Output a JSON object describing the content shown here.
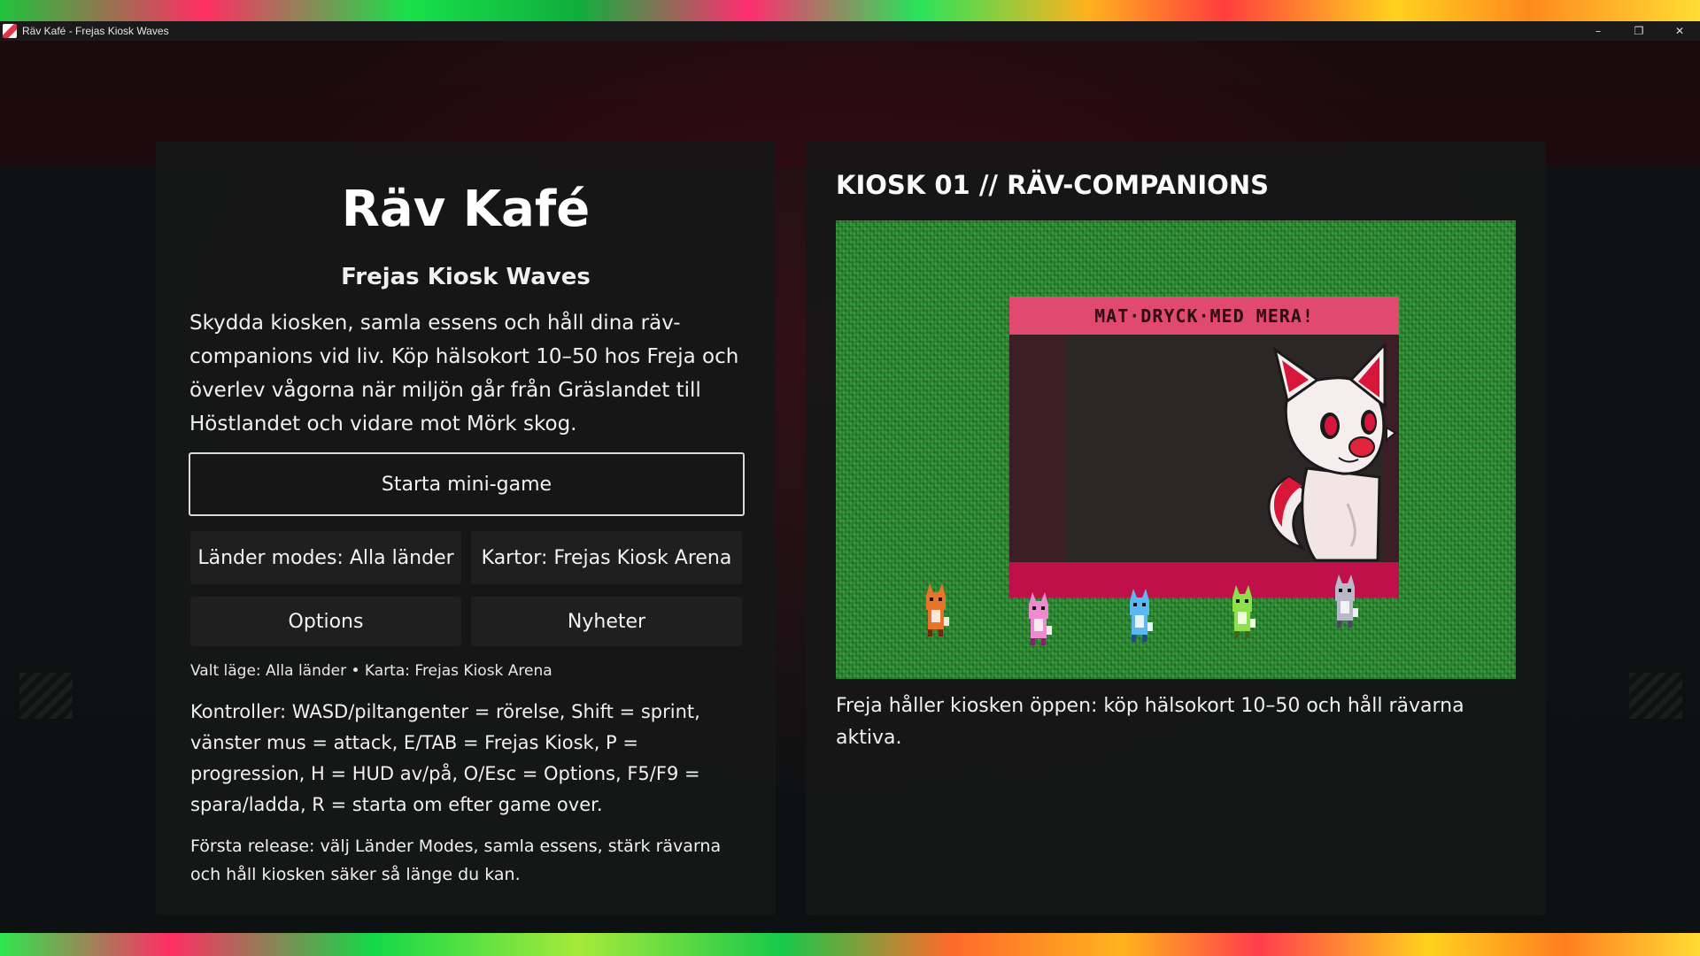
{
  "window": {
    "title": "Räv Kafé - Frejas Kiosk Waves",
    "controls": {
      "minimize": "–",
      "maximize": "❐",
      "close": "✕"
    }
  },
  "menu": {
    "title": "Räv Kafé",
    "subtitle": "Frejas Kiosk Waves",
    "intro": "Skydda kiosken, samla essens och håll dina räv-companions vid liv. Köp hälsokort 10–50 hos Freja och överlev vågorna när miljön går från Gräslandet till Höstlandet och vidare mot Mörk skog.",
    "start_button": "Starta mini-game",
    "mode_button": "Länder modes: Alla länder",
    "map_button": "Kartor: Frejas Kiosk Arena",
    "options_button": "Options",
    "news_button": "Nyheter",
    "selected_status": "Valt läge: Alla länder • Karta: Frejas Kiosk Arena",
    "controls_text": "Kontroller: WASD/piltangenter = rörelse, Shift = sprint, vänster mus = attack, E/TAB = Frejas Kiosk, P = progression, H = HUD av/på, O/Esc = Options, F5/F9 = spara/ladda, R = starta om efter game over.",
    "release_text": "Första release: välj Länder Modes, samla essens, stärk rävarna och håll kiosken säker så länge du kan."
  },
  "kiosk": {
    "heading": "KIOSK 01 // RÄV-COMPANIONS",
    "sign": "MAT·DRYCK·MED MERA!",
    "caption": "Freja håller kiosken öppen: köp hälsokort 10–50 och håll rävarna aktiva.",
    "companions": [
      {
        "color": "#e8742a"
      },
      {
        "color": "#f08ad0"
      },
      {
        "color": "#5cb8f0"
      },
      {
        "color": "#8de04a"
      },
      {
        "color": "#b8b8c8"
      }
    ]
  },
  "colors": {
    "accent": "#e04a6e",
    "counter": "#c0104a",
    "grass": "#2b8a34"
  }
}
